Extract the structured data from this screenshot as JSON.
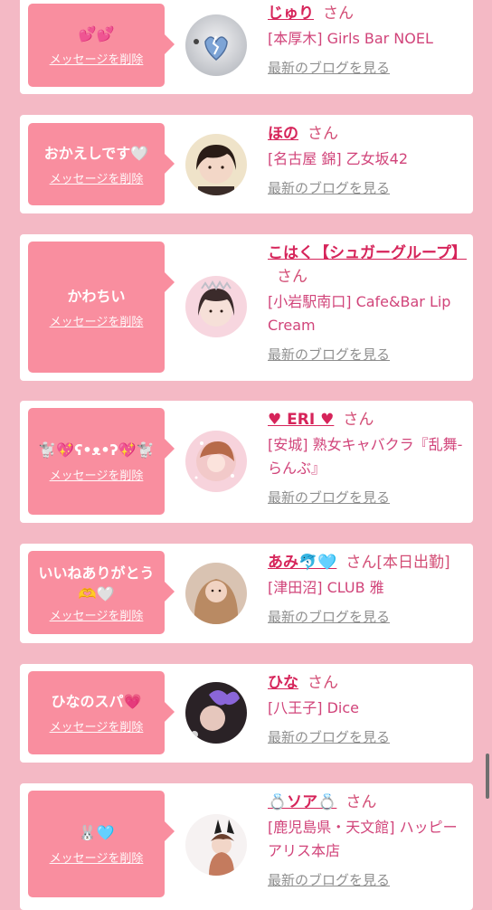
{
  "common": {
    "delete_label": "メッセージを削除",
    "blog_label": "最新のブログを見る",
    "honorific": "さん"
  },
  "items": [
    {
      "message": "💕💕",
      "name": "じゅり",
      "name_extra": "",
      "shop": "[本厚木] Girls Bar NOEL"
    },
    {
      "message": "おかえしです🤍",
      "name": "ほの",
      "name_extra": "",
      "shop": "[名古屋 錦] 乙女坂42"
    },
    {
      "message": "かわちい",
      "name": "こはく【シュガーグループ】",
      "name_extra": "",
      "shop": "[小岩駅南口] Cafe&Bar Lip Cream"
    },
    {
      "message": "🐩💖ʕ•ᴥ•ʔ💖🐩",
      "name": "♥ ERI ♥",
      "name_extra": "",
      "shop": "[安城] 熟女キャバクラ『乱舞-らんぶ』"
    },
    {
      "message": "いいねありがとう🫶🤍",
      "name": "あみ🐬🩵",
      "name_extra": "[本日出勤]",
      "shop": "[津田沼] CLUB 雅"
    },
    {
      "message": "ひなのスパ💗",
      "name": "ひな",
      "name_extra": "",
      "shop": "[八王子] Dice"
    },
    {
      "message": "🐰🩵",
      "name": "💍ソア💍",
      "name_extra": "",
      "shop": "[鹿児島県・天文館] ハッピーアリス本店"
    }
  ],
  "colors": {
    "page_background": "#f4b9c5",
    "bubble": "#f98e9f",
    "name": "#d6245a",
    "shop": "#d1447a",
    "blog_link": "#8f8f8f"
  },
  "icons": [
    "avatar-photo",
    "scrollbar"
  ]
}
